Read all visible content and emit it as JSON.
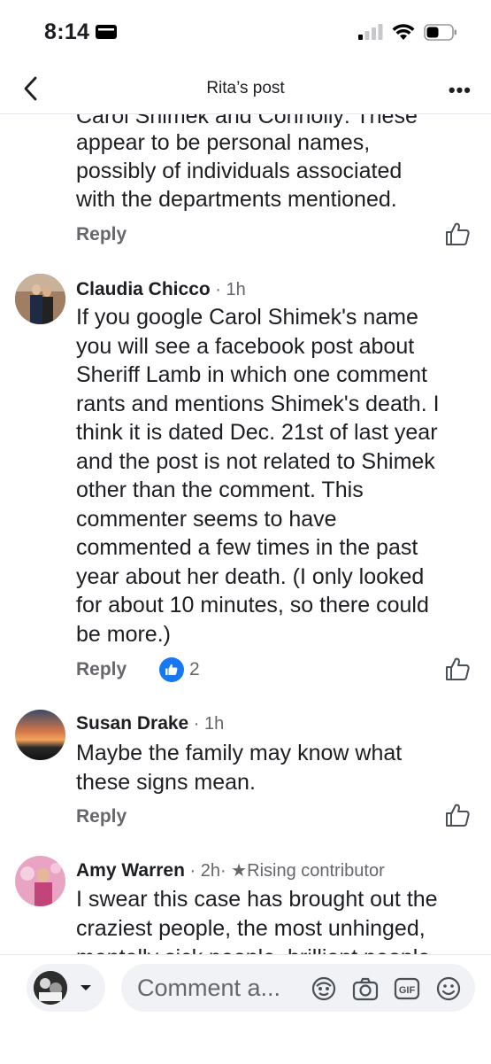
{
  "status_bar": {
    "time": "8:14"
  },
  "header": {
    "title": "Rita’s post"
  },
  "comments": [
    {
      "partial_top_line": "Carol Shimek and Connolly: These",
      "lines": [
        "appear to be personal names,",
        "possibly of individuals associated",
        "with the departments mentioned."
      ],
      "reply_label": "Reply"
    },
    {
      "author": "Claudia Chicco",
      "time": "1h",
      "lines": [
        "If you google Carol Shimek's name",
        "you will see a facebook post about",
        "Sheriff Lamb in which one comment",
        "rants and mentions Shimek's death. I",
        "think it is dated Dec. 21st of last year",
        "and the post is not related to Shimek",
        "other than the comment. This",
        "commenter seems to have",
        "commented a few times in the past",
        "year about her death. (I only looked",
        "for about 10 minutes, so there could",
        "be more.)"
      ],
      "reply_label": "Reply",
      "like_count": "2"
    },
    {
      "author": "Susan Drake",
      "time": "1h",
      "lines": [
        "Maybe the family may know what",
        "these signs mean."
      ],
      "reply_label": "Reply"
    },
    {
      "author": "Amy Warren",
      "time": "2h·",
      "badge": "Rising contributor",
      "lines": [
        "I swear this case has brought out the",
        "craziest people, the most unhinged,",
        "mentally sick people, brilliant people"
      ]
    }
  ],
  "composer": {
    "placeholder": "Comment a..."
  },
  "colors": {
    "like_blue": "#1877f2",
    "secondary_text": "#65676b"
  }
}
